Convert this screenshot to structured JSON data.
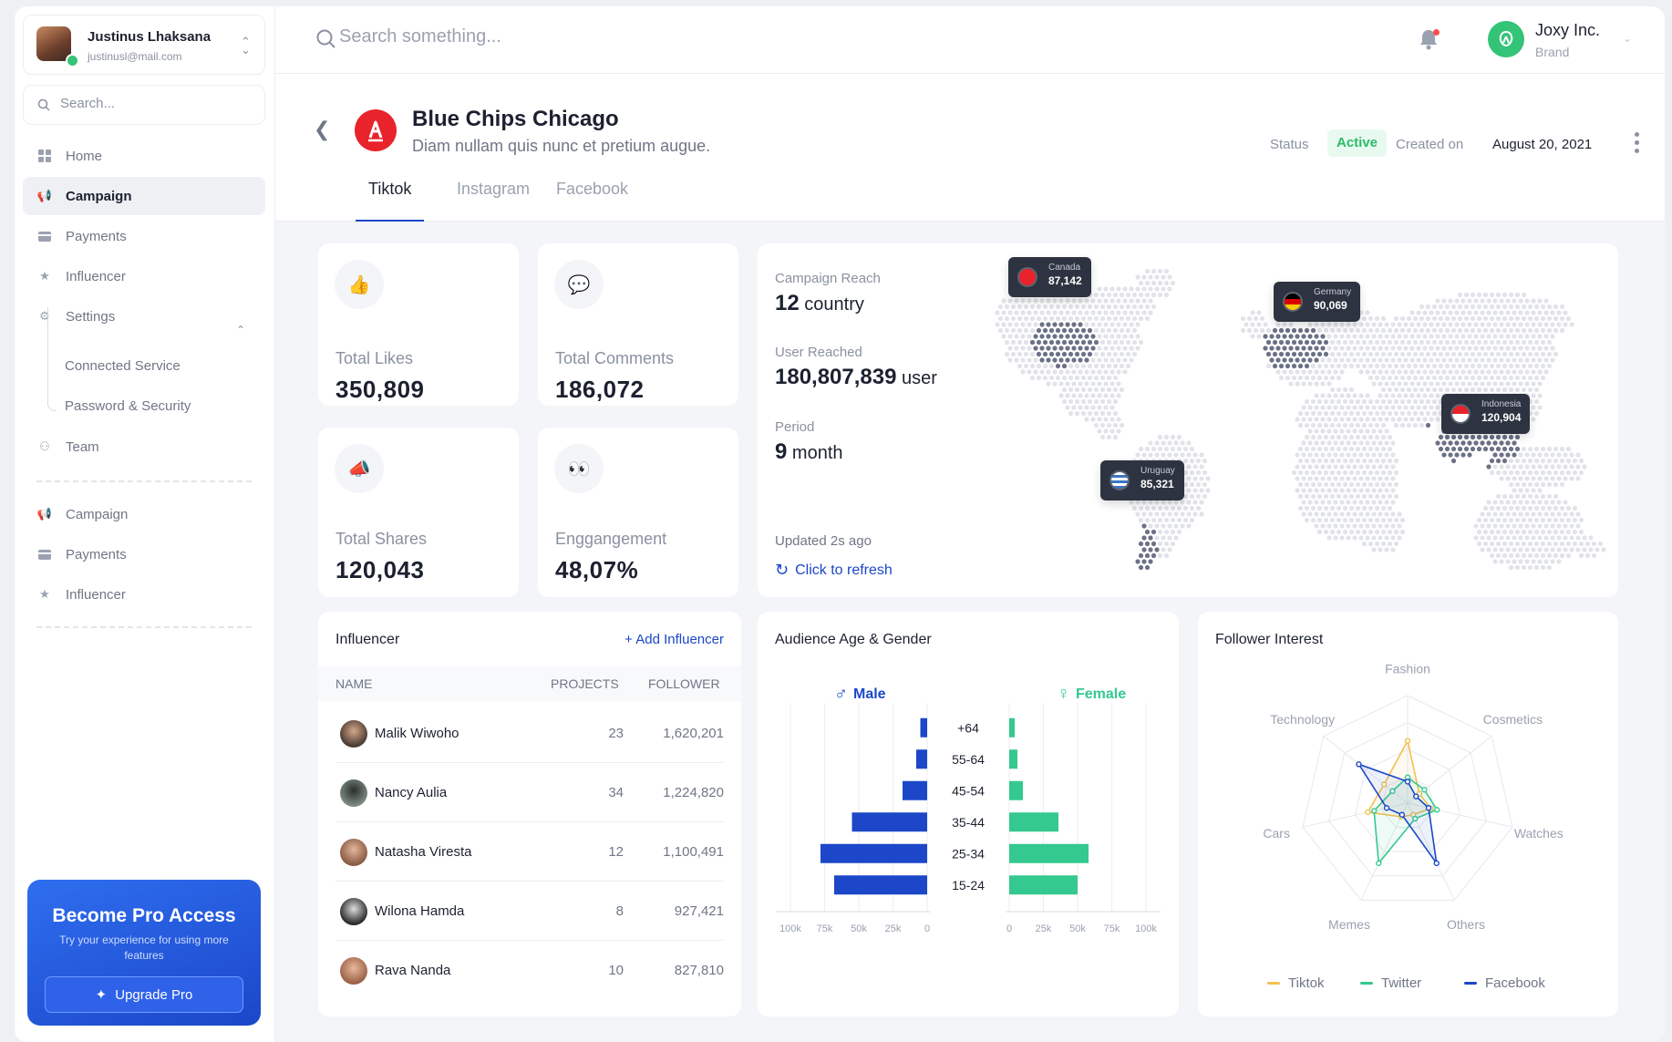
{
  "colors": {
    "accent": "#1b47c8",
    "male": "#1b47c8",
    "female": "#34c98e",
    "active": "#2eba6b",
    "tiktok": "#f2c14e",
    "twitter": "#34c98e",
    "facebook": "#1b47c8"
  },
  "sidebar": {
    "user": {
      "name": "Justinus Lhaksana",
      "email": "justinusl@mail.com"
    },
    "search_placeholder": "Search...",
    "nav": [
      {
        "label": "Home",
        "icon": "grid-icon"
      },
      {
        "label": "Campaign",
        "icon": "megaphone-icon"
      },
      {
        "label": "Payments",
        "icon": "card-icon"
      },
      {
        "label": "Influencer",
        "icon": "star-icon"
      },
      {
        "label": "Settings",
        "icon": "gear-icon"
      },
      {
        "label": "Connected Service"
      },
      {
        "label": "Password & Security"
      },
      {
        "label": "Team",
        "icon": "team-icon"
      }
    ],
    "nav2": [
      {
        "label": "Campaign",
        "icon": "megaphone-icon"
      },
      {
        "label": "Payments",
        "icon": "card-icon"
      },
      {
        "label": "Influencer",
        "icon": "star-icon"
      }
    ],
    "pro": {
      "title": "Become Pro Access",
      "desc": "Try your experience for using more features",
      "button": "Upgrade Pro"
    }
  },
  "header": {
    "search_placeholder": "Search something...",
    "brand": {
      "name": "Joxy Inc.",
      "role": "Brand"
    }
  },
  "campaign": {
    "title": "Blue Chips Chicago",
    "subtitle": "Diam nullam quis nunc et pretium augue.",
    "status_label": "Status",
    "status": "Active",
    "created_label": "Created on",
    "created_date": "August 20, 2021",
    "tabs": [
      "Tiktok",
      "Instagram",
      "Facebook"
    ]
  },
  "stats": [
    {
      "label": "Total Likes",
      "value": "350,809",
      "icon": "thumbs-up-icon"
    },
    {
      "label": "Total Comments",
      "value": "186,072",
      "icon": "speech-bubble-icon"
    },
    {
      "label": "Total Shares",
      "value": "120,043",
      "icon": "megaphone-icon"
    },
    {
      "label": "Enggangement",
      "value": "48,07%",
      "icon": "eyes-icon"
    }
  ],
  "reach": {
    "reach_label": "Campaign Reach",
    "reach_value": "12",
    "reach_unit": "country",
    "user_label": "User Reached",
    "user_value": "180,807,839",
    "user_unit": "user",
    "period_label": "Period",
    "period_value": "9",
    "period_unit": "month",
    "updated": "Updated 2s ago",
    "refresh": "Click to refresh",
    "markers": [
      {
        "name": "Canada",
        "value": "87,142"
      },
      {
        "name": "Germany",
        "value": "90,069"
      },
      {
        "name": "Indonesia",
        "value": "120,904"
      },
      {
        "name": "Uruguay",
        "value": "85,321"
      }
    ]
  },
  "influencer": {
    "title": "Influencer",
    "add": "+ Add Influencer",
    "columns": [
      "NAME",
      "PROJECTS",
      "FOLLOWER"
    ],
    "rows": [
      {
        "name": "Malik Wiwoho",
        "projects": "23",
        "followers": "1,620,201"
      },
      {
        "name": "Nancy Aulia",
        "projects": "34",
        "followers": "1,224,820"
      },
      {
        "name": "Natasha Viresta",
        "projects": "12",
        "followers": "1,100,491"
      },
      {
        "name": "Wilona Hamda",
        "projects": "8",
        "followers": "927,421"
      },
      {
        "name": "Rava Nanda",
        "projects": "10",
        "followers": "827,810"
      }
    ]
  },
  "audience": {
    "title": "Audience Age & Gender",
    "male_label": "Male",
    "female_label": "Female"
  },
  "interest": {
    "title": "Follower Interest",
    "legend": [
      "Tiktok",
      "Twitter",
      "Facebook"
    ]
  },
  "chart_data": [
    {
      "type": "bar",
      "orientation": "horizontal-butterfly",
      "categories": [
        "+64",
        "55-64",
        "45-54",
        "35-44",
        "25-34",
        "15-24"
      ],
      "series": [
        {
          "name": "Male",
          "values": [
            5000,
            8000,
            18000,
            55000,
            78000,
            68000
          ]
        },
        {
          "name": "Female",
          "values": [
            4000,
            6000,
            10000,
            36000,
            58000,
            50000
          ]
        }
      ],
      "xticks": [
        "100k",
        "75k",
        "50k",
        "25k",
        "0"
      ],
      "xticks_right": [
        "0",
        "25k",
        "50k",
        "75k",
        "100k"
      ],
      "xlim": [
        0,
        100000
      ],
      "grid": true
    },
    {
      "type": "radar",
      "categories": [
        "Fashion",
        "Cosmetics",
        "Watches",
        "Others",
        "Memes",
        "Cars",
        "Technology"
      ],
      "rlim": [
        0,
        1
      ],
      "series": [
        {
          "name": "Tiktok",
          "values": [
            0.58,
            0.14,
            0.22,
            0.12,
            0.14,
            0.38,
            0.28
          ]
        },
        {
          "name": "Twitter",
          "values": [
            0.24,
            0.2,
            0.28,
            0.16,
            0.62,
            0.32,
            0.18
          ]
        },
        {
          "name": "Facebook",
          "values": [
            0.2,
            0.1,
            0.2,
            0.62,
            0.12,
            0.2,
            0.58
          ]
        }
      ],
      "grid": true
    }
  ]
}
